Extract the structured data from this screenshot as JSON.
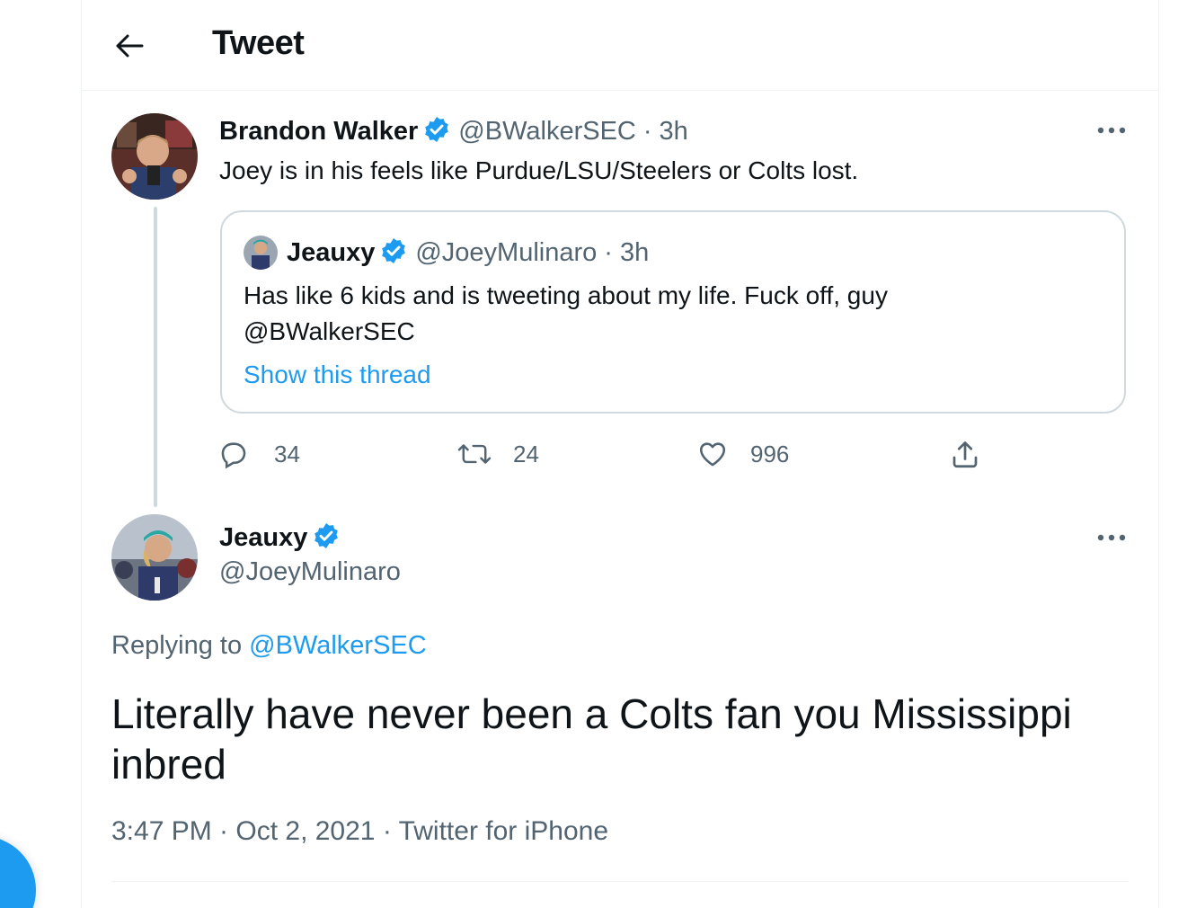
{
  "header": {
    "title": "Tweet"
  },
  "quoting_tweet": {
    "name": "Brandon Walker",
    "handle": "@BWalkerSEC",
    "separator": "·",
    "time": "3h",
    "text": "Joey is in his feels like Purdue/LSU/Steelers or Colts lost.",
    "quoted": {
      "name": "Jeauxy",
      "handle": "@JoeyMulinaro",
      "separator": "·",
      "time": "3h",
      "text_line1": "Has like 6 kids and is tweeting about my life. Fuck off, guy",
      "text_line2": "@BWalkerSEC",
      "show_thread": "Show this thread"
    },
    "actions": {
      "replies": "34",
      "retweets": "24",
      "likes": "996"
    }
  },
  "main_tweet": {
    "name": "Jeauxy",
    "handle": "@JoeyMulinaro",
    "replying_prefix": "Replying to ",
    "replying_to": "@BWalkerSEC",
    "text": "Literally have never been a Colts fan you Mississippi inbred",
    "meta": "3:47 PM · Oct 2, 2021 · Twitter for iPhone"
  },
  "colors": {
    "accent": "#1d9bf0",
    "secondary_text": "#536471",
    "border": "#cfd9de"
  }
}
